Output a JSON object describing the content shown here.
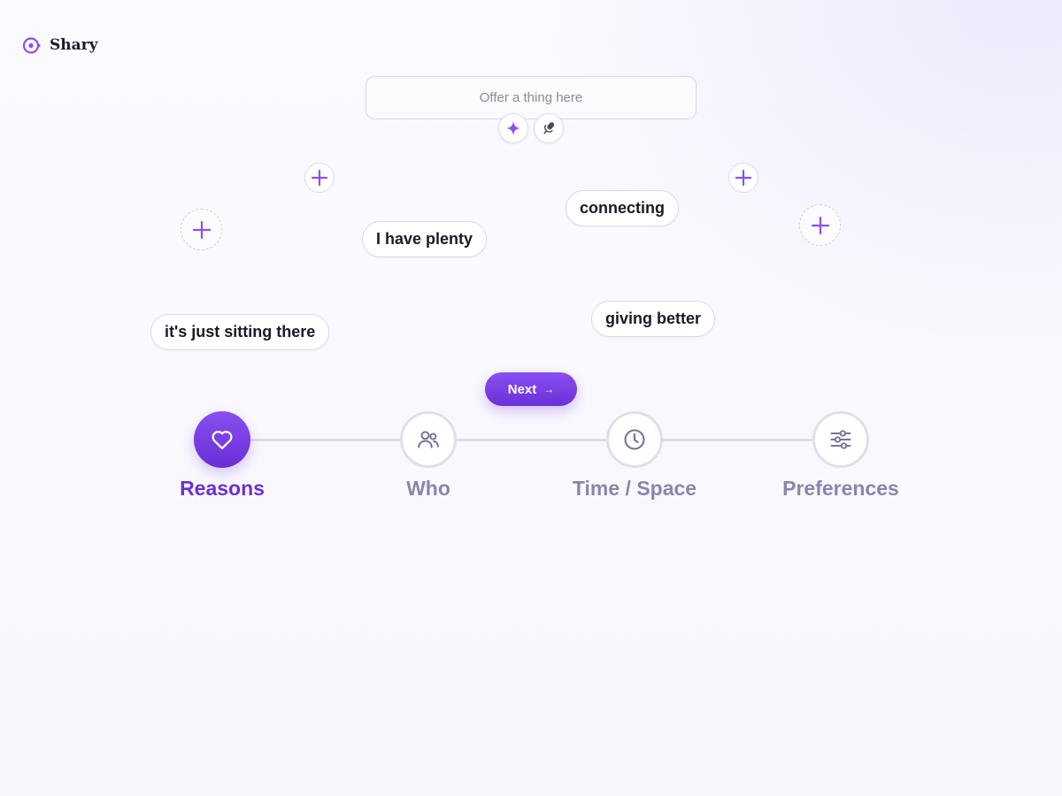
{
  "brand": {
    "name": "Shary",
    "logo_icon": "target-dot-icon",
    "accent": "#8b4ff0"
  },
  "offer": {
    "placeholder": "Offer a thing here",
    "value": "",
    "buttons": [
      {
        "icon": "sparkle-icon"
      },
      {
        "icon": "microphone-icon"
      }
    ]
  },
  "reasons": {
    "chips": [
      "connecting",
      "I have plenty",
      "it's just sitting there",
      "giving better"
    ],
    "add_buttons_icon": "plus-icon"
  },
  "next_button": {
    "label": "Next",
    "arrow": "→",
    "color": "#7a3fe6"
  },
  "stepper": {
    "active_index": 0,
    "active_color": "#6c2fd4",
    "inactive_color": "#8d84ad",
    "steps": [
      {
        "label": "Reasons",
        "icon": "heart-icon"
      },
      {
        "label": "Who",
        "icon": "people-icon"
      },
      {
        "label": "Time / Space",
        "icon": "clock-icon"
      },
      {
        "label": "Preferences",
        "icon": "sliders-icon"
      }
    ]
  }
}
